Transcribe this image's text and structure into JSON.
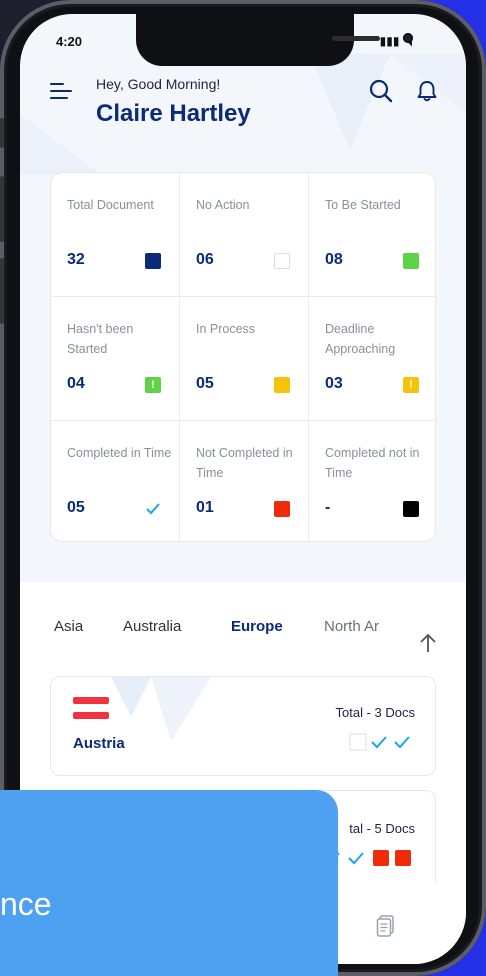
{
  "status": {
    "time": "4:20",
    "icons": "▮▮▮ ◥"
  },
  "header": {
    "greeting": "Hey, Good Morning!",
    "user_name": "Claire Hartley"
  },
  "stats": [
    {
      "label": "Total Document",
      "value": "32",
      "indicator": "navy-square"
    },
    {
      "label": "No Action",
      "value": "06",
      "indicator": "empty-square"
    },
    {
      "label": "To Be Started",
      "value": "08",
      "indicator": "green-square"
    },
    {
      "label": "Hasn't been Started",
      "value": "04",
      "indicator": "green-alert"
    },
    {
      "label": "In Process",
      "value": "05",
      "indicator": "yellow-square"
    },
    {
      "label": "Deadline Approaching",
      "value": "03",
      "indicator": "yellow-alert"
    },
    {
      "label": "Completed in Time",
      "value": "05",
      "indicator": "check-mark"
    },
    {
      "label": "Not Completed in Time",
      "value": "01",
      "indicator": "red-square"
    },
    {
      "label": "Completed not in Time",
      "value": "-",
      "indicator": "black-square"
    }
  ],
  "tabs": [
    "Asia",
    "Australia",
    "Europe",
    "North Ar"
  ],
  "active_tab": "Europe",
  "countries": [
    {
      "name": "Austria",
      "total": "Total - 3 Docs"
    },
    {
      "name": "",
      "total": "tal - 5 Docs"
    }
  ],
  "overlay": {
    "text": "nce"
  },
  "colors": {
    "primary": "#0a2a7a",
    "green": "#5fd348",
    "yellow": "#f7c30a",
    "red": "#ef2b0a",
    "check": "#1aa6e8",
    "overlay": "#4ea0f0"
  }
}
